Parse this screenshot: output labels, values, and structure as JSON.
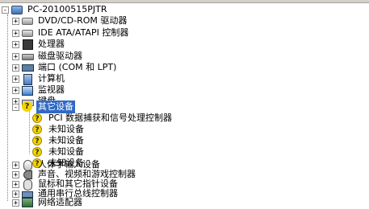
{
  "tree": {
    "root": {
      "label": "PC-20100515PJTR",
      "icon": "computer-icon"
    },
    "items": [
      {
        "label": "DVD/CD-ROM 驱动器",
        "icon": "drive-icon",
        "expander": "+"
      },
      {
        "label": "IDE ATA/ATAPI 控制器",
        "icon": "drive-icon",
        "expander": "+"
      },
      {
        "label": "处理器",
        "icon": "cpu-icon",
        "expander": "+"
      },
      {
        "label": "磁盘驱动器",
        "icon": "disk-icon",
        "expander": "+"
      },
      {
        "label": "端口 (COM 和 LPT)",
        "icon": "port-icon",
        "expander": "+"
      },
      {
        "label": "计算机",
        "icon": "pc-icon",
        "expander": "+"
      },
      {
        "label": "监视器",
        "icon": "monitor-icon",
        "expander": "+"
      },
      {
        "label": "键盘",
        "icon": "keyboard-icon",
        "expander": "+"
      },
      {
        "label": "其它设备",
        "icon": "question-icon",
        "expander": "-",
        "selected": true,
        "children": [
          {
            "label": "PCI 数据捕获和信号处理控制器"
          },
          {
            "label": "未知设备"
          },
          {
            "label": "未知设备"
          },
          {
            "label": "未知设备"
          },
          {
            "label": "未知设备"
          }
        ]
      },
      {
        "label": "人体学输入设备",
        "icon": "mouse-icon",
        "expander": "+"
      },
      {
        "label": "声音、视频和游戏控制器",
        "icon": "sound-icon",
        "expander": "+"
      },
      {
        "label": "鼠标和其它指针设备",
        "icon": "mouse2-icon",
        "expander": "+"
      },
      {
        "label": "通用串行总线控制器",
        "icon": "usb-icon",
        "expander": "+"
      },
      {
        "label": "网络适配器",
        "icon": "network-icon",
        "expander": "+"
      }
    ]
  },
  "icons": {
    "unknown_glyph": "?"
  },
  "colors": {
    "selection": "#316ac5",
    "warning": "#f3d400"
  }
}
